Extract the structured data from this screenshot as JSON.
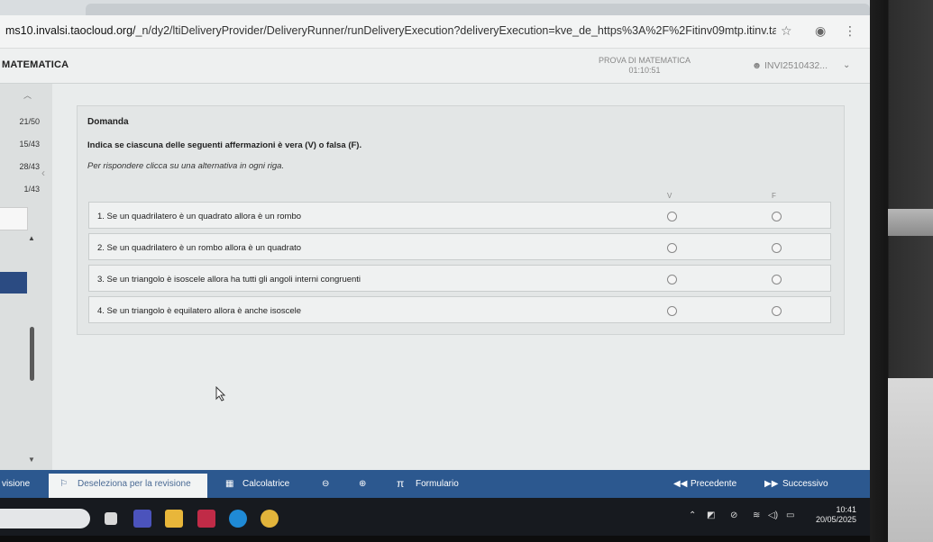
{
  "browser": {
    "url_host": "ms10.invalsi.taocloud.org/",
    "url_path": "_n/dy2/ltiDeliveryProvider/DeliveryRunner/runDeliveryExecution?deliveryExecution=kve_de_https%3A%2F%2Fitinv09mtp.itinv.taocloud.org%2F%..."
  },
  "header": {
    "title": "MATEMATICA",
    "test_name": "PROVA DI MATEMATICA",
    "timer": "01:10:51",
    "user": "INVI2510432..."
  },
  "navigator": {
    "items": [
      "21/50",
      "15/43",
      "28/43",
      "1/43"
    ]
  },
  "question": {
    "label": "Domanda",
    "prompt": "Indica se ciascuna delle seguenti affermazioni è vera (V) o falsa (F).",
    "instruction": "Per rispondere clicca su una alternativa in ogni riga.",
    "col_true": "V",
    "col_false": "F",
    "rows": [
      "1. Se un quadrilatero è un quadrato allora è un rombo",
      "2. Se un quadrilatero è un rombo allora è un quadrato",
      "3. Se un triangolo è isoscele allora ha tutti gli angoli interni congruenti",
      "4. Se un triangolo è equilatero allora è anche isoscele"
    ]
  },
  "actions": {
    "review": "visione",
    "unmark": "Deseleziona per la revisione",
    "calculator": "Calcolatrice",
    "formulas": "Formulario",
    "previous": "Precedente",
    "next": "Successivo"
  },
  "taskbar": {
    "time": "10:41",
    "date": "20/05/2025"
  },
  "colors": {
    "action_bar": "#2c588f",
    "selected_nav": "#2b4b82",
    "panel": "#e3e6e6"
  }
}
